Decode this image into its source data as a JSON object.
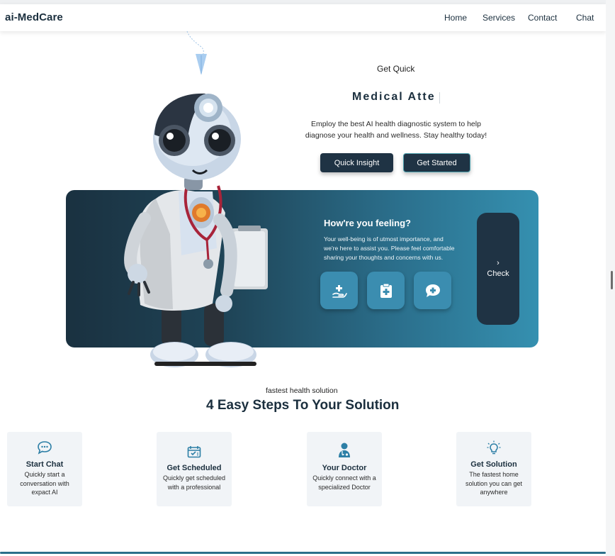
{
  "header": {
    "logo": "ai-MedCare",
    "nav": [
      "Home",
      "Services",
      "Contact",
      "Chat"
    ]
  },
  "hero": {
    "subtitle": "Get Quick",
    "title": "Medical Atte",
    "description": "Employ the best AI health diagnostic system to help diagnose your health and wellness. Stay healthy today!",
    "buttons": {
      "insight": "Quick Insight",
      "started": "Get Started"
    }
  },
  "banner": {
    "title": "How're you feeling?",
    "description": "Your well-being is of utmost importance, and we're here to assist you. Please feel comfortable sharing your thoughts and concerns with us.",
    "quick_icons": [
      "hand-medical-icon",
      "medical-clipboard-icon",
      "chat-plus-icon"
    ],
    "check": {
      "icon": "chevron-right-icon",
      "label": "Check"
    }
  },
  "steps": {
    "subtitle": "fastest health solution",
    "title": "4 Easy Steps To Your Solution",
    "cards": [
      {
        "icon": "chat-bubble-icon",
        "title": "Start Chat",
        "desc": "Quickly start a conversation with expact AI"
      },
      {
        "icon": "calendar-check-icon",
        "title": "Get Scheduled",
        "desc": "Quickly get scheduled with a professional"
      },
      {
        "icon": "doctor-icon",
        "title": "Your Doctor",
        "desc": "Quickly connect with a specialized Doctor"
      },
      {
        "icon": "lightbulb-icon",
        "title": "Get Solution",
        "desc": "The fastest home solution you can get anywhere"
      }
    ]
  },
  "colors": {
    "brand_dark": "#1f3344",
    "banner_start": "#1a3140",
    "banner_end": "#3590b0",
    "icon_button": "#3b8db0",
    "step_icon": "#2d7fa6",
    "card_bg": "#f1f4f7"
  }
}
